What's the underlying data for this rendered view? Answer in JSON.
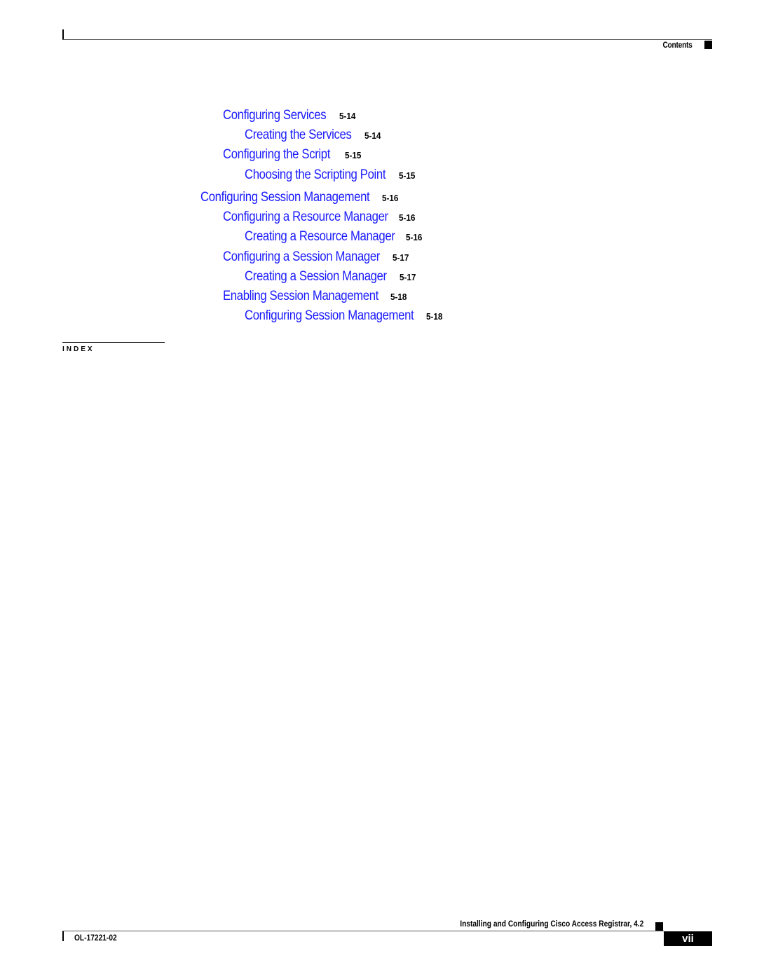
{
  "header": {
    "section": "Contents"
  },
  "toc": {
    "entries": [
      {
        "title": "Configuring Services",
        "page": "5-14",
        "level": 2
      },
      {
        "title": "Creating the Services",
        "page": "5-14",
        "level": 3
      },
      {
        "title": "Configuring the Script",
        "page": "5-15",
        "level": 2
      },
      {
        "title": "Choosing the Scripting Point",
        "page": "5-15",
        "level": 3
      },
      {
        "title": "Configuring Session Management",
        "page": "5-16",
        "level": 1
      },
      {
        "title": "Configuring a Resource Manager",
        "page": "5-16",
        "level": 2
      },
      {
        "title": "Creating a Resource Manager",
        "page": "5-16",
        "level": 3
      },
      {
        "title": "Configuring a Session Manager",
        "page": "5-17",
        "level": 2
      },
      {
        "title": "Creating a Session Manager",
        "page": "5-17",
        "level": 3
      },
      {
        "title": "Enabling Session Management",
        "page": "5-18",
        "level": 2
      },
      {
        "title": "Configuring Session Management",
        "page": "5-18",
        "level": 3
      }
    ],
    "link_color": "#1a1aff"
  },
  "index": {
    "label": "INDEX"
  },
  "footer": {
    "book_title": "Installing and Configuring Cisco Access Registrar, 4.2",
    "doc_number": "OL-17221-02",
    "page_number": "vii"
  }
}
